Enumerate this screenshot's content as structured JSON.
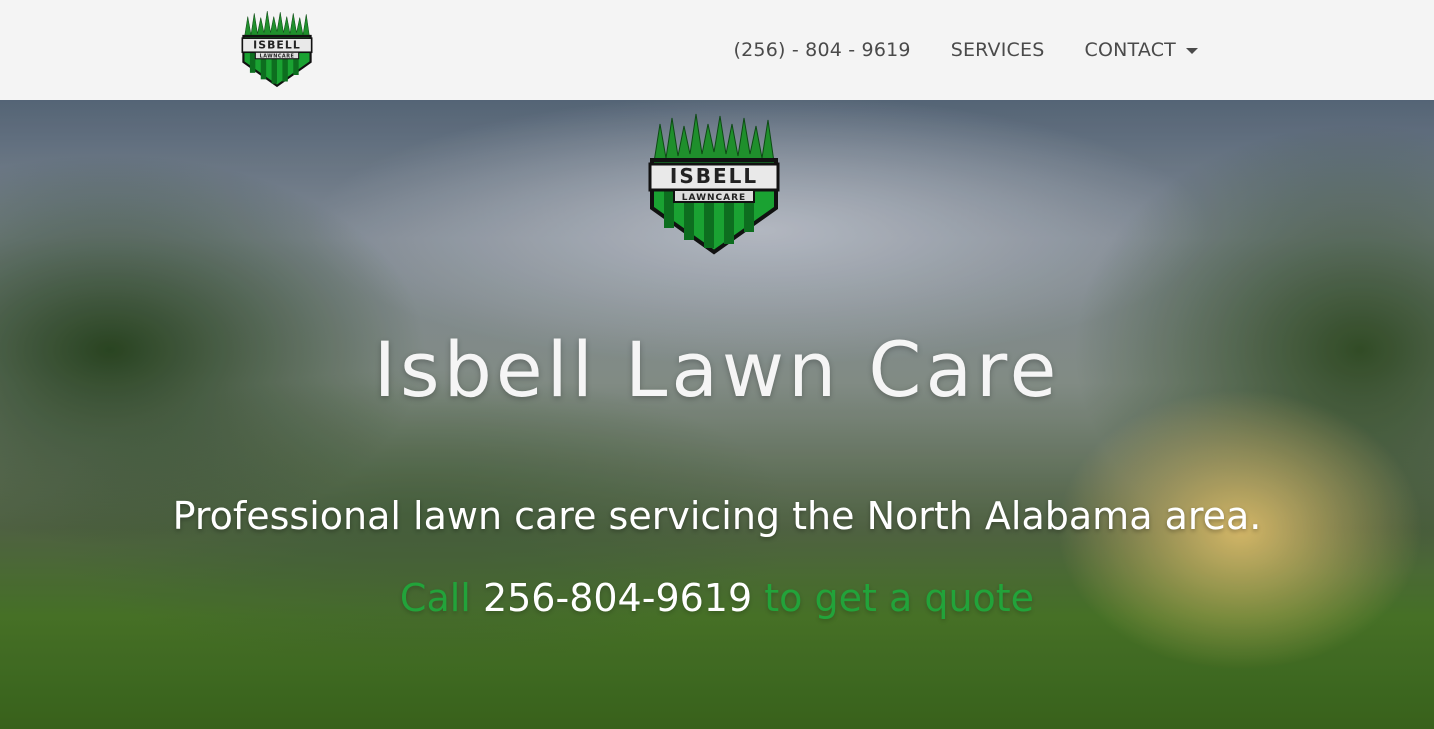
{
  "nav": {
    "logo_icon": "isbell-lawncare-logo",
    "links": {
      "phone": "(256) - 804 - 9619",
      "services": "SERVICES",
      "contact": "CONTACT"
    }
  },
  "hero": {
    "logo_icon": "isbell-lawncare-logo",
    "logo_text_top": "ISBELL",
    "logo_text_bottom": "LAWNCARE",
    "title": "Isbell Lawn Care",
    "subtitle": "Professional lawn care servicing the North Alabama area.",
    "cta": {
      "prefix": "Call",
      "phone": "256-804-9619",
      "suffix": "to get a quote"
    }
  },
  "colors": {
    "nav_bg": "#f4f4f4",
    "nav_text": "#4a4a4a",
    "accent_green": "#22a33a",
    "hero_text": "#ffffff"
  }
}
